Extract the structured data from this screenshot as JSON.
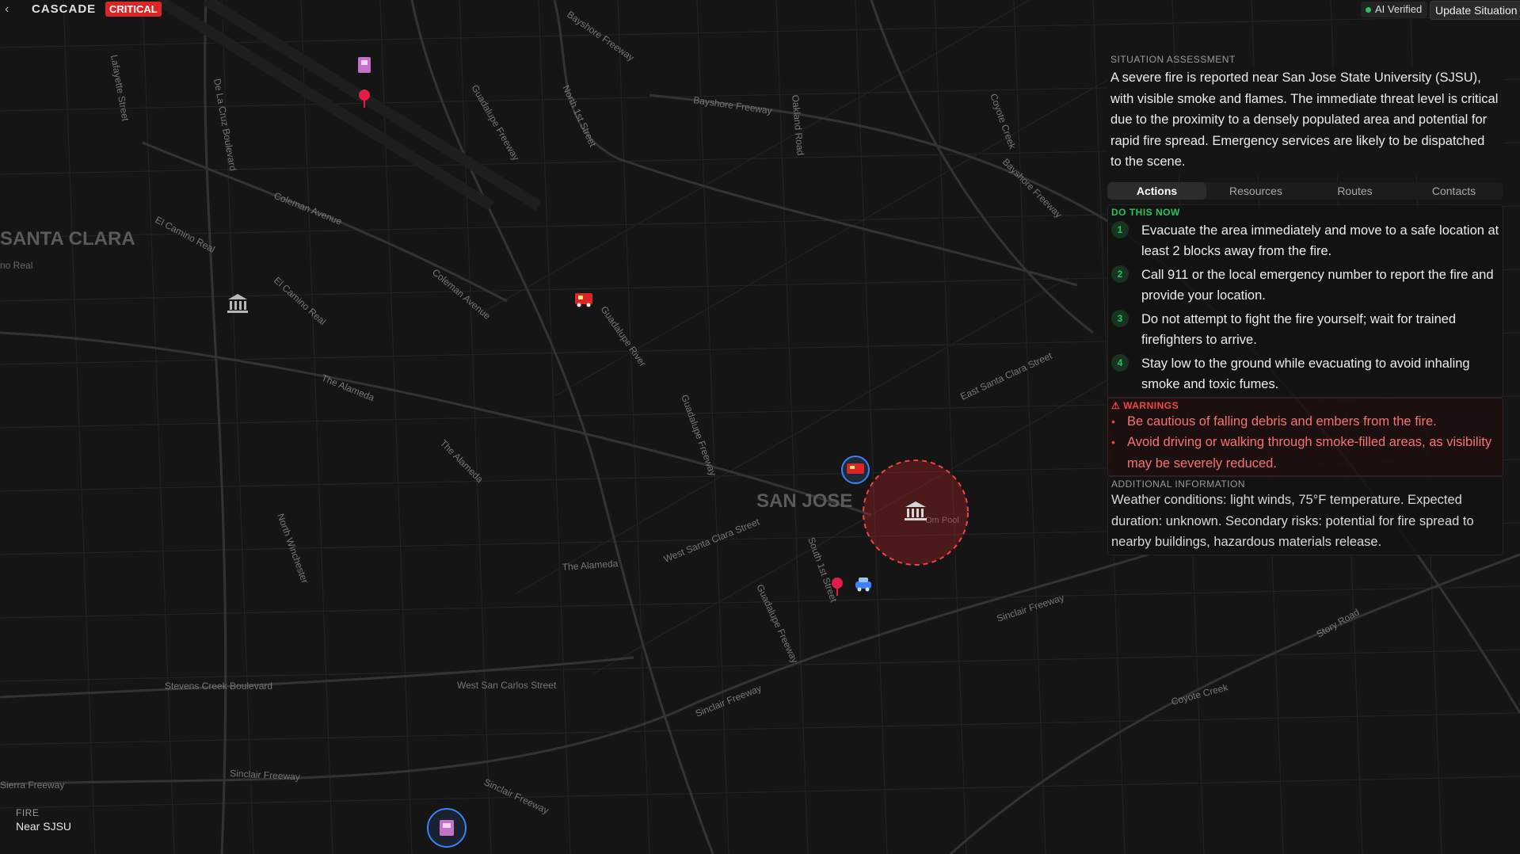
{
  "header": {
    "back_icon": "chevron-left-icon",
    "app_name": "CASCADE",
    "severity": "CRITICAL",
    "ai_verified": "AI Verified",
    "update_button": "Update Situation"
  },
  "map": {
    "labels": {
      "santa_clara": "SANTA CLARA",
      "san_jose": "SAN JOSE",
      "el_camino_real": "El Camino Real",
      "no_real": "no Real",
      "coleman_avenue": "Coleman Avenue",
      "coleman_avenue_2": "Coleman Avenue",
      "the_alameda": "The Alameda",
      "the_alameda_2": "The Alameda",
      "the_alameda_3": "The Alameda",
      "bayshore_freeway": "Bayshore Freeway",
      "bayshore_freeway_2": "Bayshore Freeway",
      "bayshore_freeway_3": "Bayshore Freeway",
      "guadalupe_freeway": "Guadalupe Freeway",
      "guadalupe_freeway_2": "Guadalupe Freeway",
      "guadalupe_freeway_3": "Guadalupe Freeway",
      "sinclair_freeway": "Sinclair Freeway",
      "sinclair_freeway_2": "Sinclair Freeway",
      "sinclair_freeway_3": "Sinclair Freeway",
      "sinclair_freeway_4": "Sinclair Freeway",
      "stevens_creek": "Stevens Creek Boulevard",
      "west_san_carlos": "West San Carlos Street",
      "west_santa_clara": "West Santa Clara Street",
      "east_santa_clara": "East Santa Clara Street",
      "north_1st": "North 1st Street",
      "oakland_road": "Oakland Road",
      "coyote_creek": "Coyote Creek",
      "coyote_creek_2": "Coyote Creek",
      "story_road": "Story Road",
      "sierra_freeway": "Sierra Freeway",
      "guadalupe_river": "Guadalupe River",
      "lafayette": "Lafayette Street",
      "de_la_cruz": "De La Cruz Boulevard",
      "north_winchester": "North Winchester",
      "south_1st": "South 1st Street",
      "pool": "Om Pool"
    },
    "markers": [
      {
        "icon": "hospital-icon",
        "name": "hospital-marker"
      },
      {
        "icon": "location-pin-icon",
        "name": "location-pin-marker"
      },
      {
        "icon": "government-building-icon",
        "name": "government-building-marker"
      },
      {
        "icon": "fire-truck-icon",
        "name": "fire-station-marker"
      },
      {
        "icon": "fire-truck-icon",
        "name": "fire-truck-unit-marker"
      },
      {
        "icon": "government-building-icon",
        "name": "incident-building-marker"
      },
      {
        "icon": "location-pin-icon",
        "name": "location-pin-marker-2"
      },
      {
        "icon": "police-car-icon",
        "name": "police-car-marker"
      },
      {
        "icon": "hospital-icon",
        "name": "hospital-unit-marker"
      }
    ],
    "incident_color": "#dc2626"
  },
  "assessment": {
    "title": "SITUATION ASSESSMENT",
    "text": "A severe fire is reported near San Jose State University (SJSU), with visible smoke and flames. The immediate threat level is critical due to the proximity to a densely populated area and potential for rapid fire spread. Emergency services are likely to be dispatched to the scene."
  },
  "tabs": [
    "Actions",
    "Resources",
    "Routes",
    "Contacts"
  ],
  "actions": {
    "title": "DO THIS NOW",
    "items": [
      {
        "num": "1",
        "text": "Evacuate the area immediately and move to a safe location at least 2 blocks away from the fire."
      },
      {
        "num": "2",
        "text": "Call 911 or the local emergency number to report the fire and provide your location."
      },
      {
        "num": "3",
        "text": "Do not attempt to fight the fire yourself; wait for trained firefighters to arrive."
      },
      {
        "num": "4",
        "text": "Stay low to the ground while evacuating to avoid inhaling smoke and toxic fumes."
      }
    ]
  },
  "warnings": {
    "title": "⚠ WARNINGS",
    "items": [
      "Be cautious of falling debris and embers from the fire.",
      "Avoid driving or walking through smoke-filled areas, as visibility may be severely reduced."
    ]
  },
  "additional": {
    "title": "ADDITIONAL INFORMATION",
    "text": "Weather conditions: light winds, 75°F temperature. Expected duration: unknown. Secondary risks: potential for fire spread to nearby buildings, hazardous materials release."
  },
  "incident_label": {
    "type": "FIRE",
    "location": "Near SJSU"
  },
  "colors": {
    "background": "#151515",
    "accent_green": "#22c55e",
    "warning_red": "#ef4444",
    "critical_badge": "#dc2626"
  }
}
